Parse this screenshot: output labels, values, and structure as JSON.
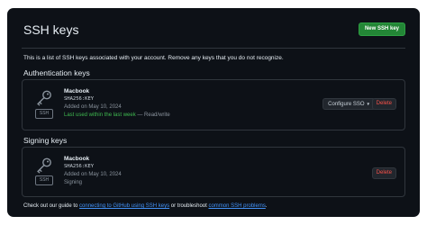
{
  "header": {
    "title": "SSH keys",
    "new_key_label": "New SSH key"
  },
  "intro_text": "This is a list of SSH keys associated with your account. Remove any keys that you do not recognize.",
  "authentication": {
    "heading": "Authentication keys",
    "key": {
      "badge": "SSH",
      "name": "Macbook",
      "fingerprint": "SHA256:KEY",
      "added": "Added on May 10, 2024",
      "last_used": "Last used within the last week",
      "access": " — Read/write",
      "configure_label": "Configure SSO",
      "delete_label": "Delete"
    }
  },
  "signing": {
    "heading": "Signing keys",
    "key": {
      "badge": "SSH",
      "name": "Macbook",
      "fingerprint": "SHA256:KEY",
      "added": "Added on May 10, 2024",
      "usage": "Signing",
      "delete_label": "Delete"
    }
  },
  "footer": {
    "prefix": "Check out our guide to ",
    "link1": "connecting to GitHub using SSH keys",
    "middle": " or troubleshoot ",
    "link2": "common SSH problems",
    "suffix": "."
  },
  "icons": {
    "key": "key-icon",
    "caret": "triangle-down-icon"
  },
  "colors": {
    "background": "#0d1117",
    "border": "#30363d",
    "primary_button": "#238636",
    "danger": "#f85149",
    "success": "#3fb950",
    "link": "#4493f8"
  }
}
